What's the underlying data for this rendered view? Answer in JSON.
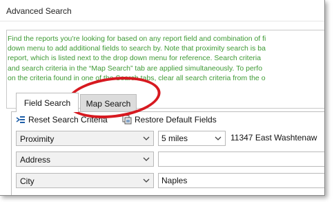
{
  "window": {
    "title": "Advanced Search"
  },
  "info": {
    "lines": [
      "Find the reports you're looking for based on any report field and combination of fi",
      "down menu to add additional fields to search by.  Note that proximity search is ba",
      "report, which is listed next to the drop down menu for reference.  Search criteria",
      "and search criteria in the “Map Search” tab are applied simultaneously.  To perfo",
      "on the criteria found in one of the Search tabs, clear all search criteria from the o"
    ]
  },
  "tabs": [
    {
      "label": "Field Search",
      "active": true
    },
    {
      "label": "Map Search",
      "active": false
    }
  ],
  "toolbar": {
    "reset_label": "Reset Search Criteria",
    "restore_label": "Restore Default Fields"
  },
  "rows": [
    {
      "field": "Proximity",
      "value": "5 miles",
      "extra": "11347 East Washtenaw"
    },
    {
      "field": "Address",
      "value": ""
    },
    {
      "field": "City",
      "value": "Naples"
    }
  ],
  "colors": {
    "info_text": "#3e9a34",
    "highlight_ring": "#d71920",
    "inactive_tab": "#dcdcdc"
  }
}
